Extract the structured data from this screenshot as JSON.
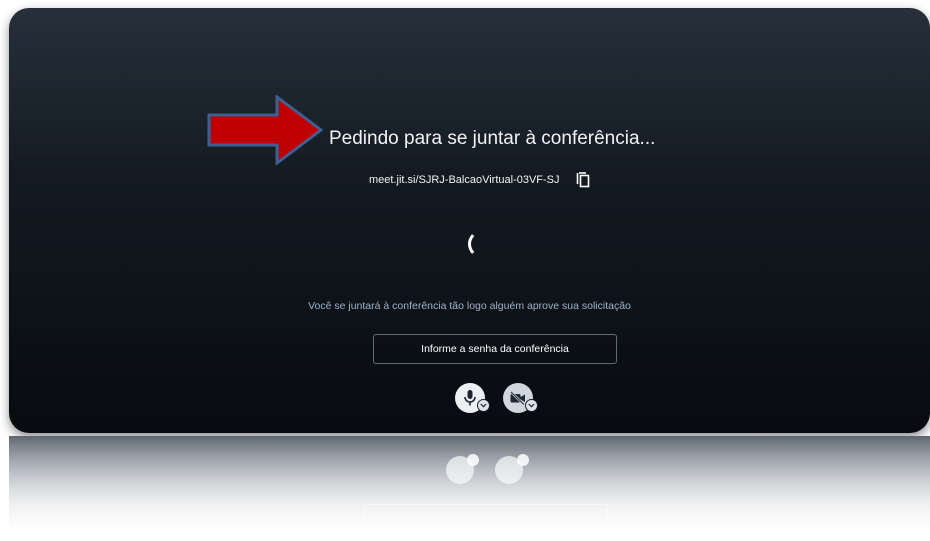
{
  "lobby": {
    "title": "Pedindo para se juntar à conferência...",
    "meeting_url": "meet.jit.si/SJRJ-BalcaoVirtual-03VF-SJ",
    "waiting_message": "Você se juntará à conferência tão logo alguém aprove sua solicitação",
    "password_button_label": "Informe a senha da conferência"
  },
  "controls": {
    "mic_icon": "microphone-icon",
    "camera_icon": "camera-off-icon",
    "copy_icon": "copy-icon"
  },
  "colors": {
    "card_background": "#121920",
    "arrow_fill": "#c00000",
    "arrow_stroke": "#3f5f8f",
    "waiting_text": "#9fb2c8"
  }
}
